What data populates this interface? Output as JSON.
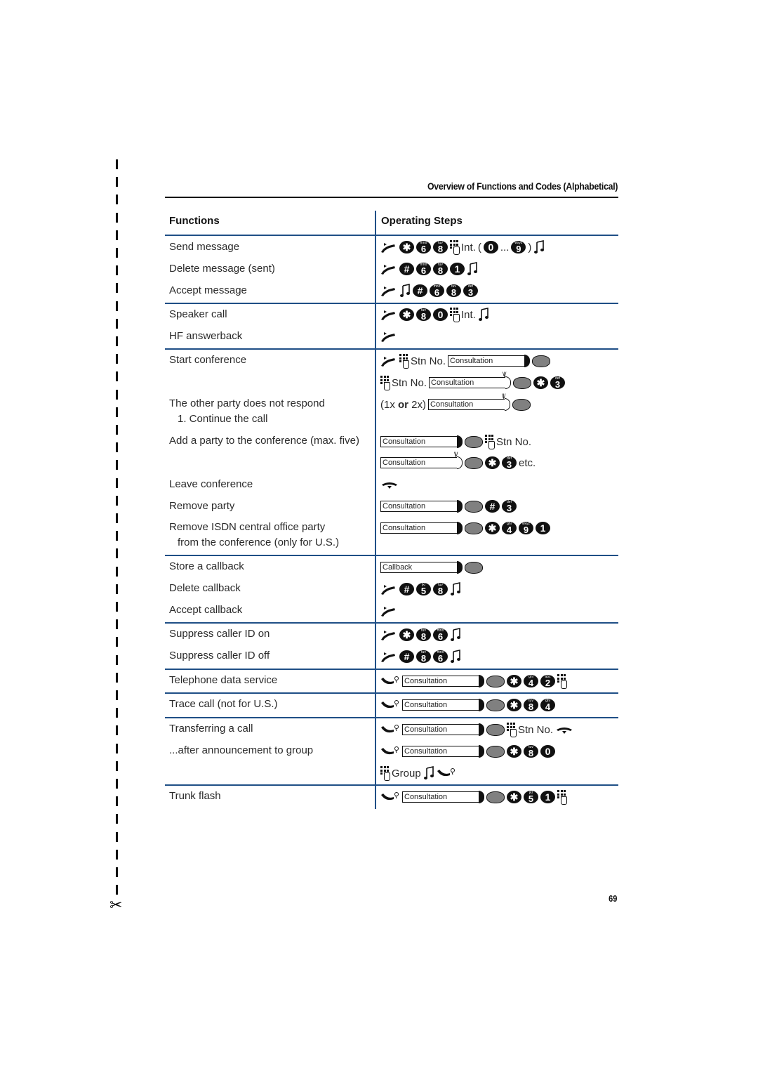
{
  "page": {
    "section_title": "Overview of Functions and Codes (Alphabetical)",
    "page_number": "69",
    "cut_line_icon": "scissors-icon"
  },
  "table": {
    "headers": {
      "functions": "Functions",
      "steps": "Operating Steps"
    },
    "groups": [
      {
        "rows": [
          {
            "function": "Send message",
            "steps": [
              "lift-handset-icon",
              "*",
              "6",
              "8",
              "keypad-icon",
              "Int.",
              "(",
              "0",
              "...",
              "9",
              ")",
              "tone-icon"
            ]
          },
          {
            "function": "Delete message (sent)",
            "steps": [
              "lift-handset-icon",
              "#",
              "6",
              "8",
              "1",
              "tone-icon"
            ]
          },
          {
            "function": "Accept message",
            "steps": [
              "lift-handset-icon",
              "tone-icon",
              "#",
              "6",
              "8",
              "3"
            ]
          }
        ]
      },
      {
        "rows": [
          {
            "function": "Speaker call",
            "steps": [
              "lift-handset-icon",
              "*",
              "8",
              "0",
              "keypad-icon",
              "Int.",
              "tone-icon"
            ]
          },
          {
            "function": "HF answerback",
            "steps": [
              "lift-handset-icon"
            ]
          }
        ]
      },
      {
        "rows": [
          {
            "function": "Start conference",
            "steps": [
              "lift-handset-icon",
              "keypad-icon",
              "Stn No.",
              "Consultation",
              "menu-knob"
            ]
          },
          {
            "function": "",
            "steps": [
              "keypad-icon",
              "Stn No.",
              "Consultation (blinking)",
              "menu-knob",
              "*",
              "3"
            ]
          },
          {
            "function": "The other party does not respond",
            "steps": [
              "(1x or 2x)",
              "Consultation (blinking)",
              "menu-knob"
            ]
          },
          {
            "function": "1. Continue the call",
            "steps": []
          },
          {
            "function": "Add a party to the conference (max. five)",
            "steps": [
              "Consultation",
              "menu-knob",
              "keypad-icon",
              "Stn No."
            ]
          },
          {
            "function": "",
            "steps": [
              "Consultation (blinking)",
              "menu-knob",
              "*",
              "3",
              "etc."
            ]
          },
          {
            "function": "Leave conference",
            "steps": [
              "hang-up-icon"
            ]
          },
          {
            "function": "Remove party",
            "steps": [
              "Consultation",
              "menu-knob",
              "#",
              "3"
            ]
          },
          {
            "function": "Remove ISDN central office party",
            "steps": [
              "Consultation",
              "menu-knob",
              "*",
              "4",
              "9",
              "1"
            ]
          },
          {
            "function": "from the conference (only for U.S.)",
            "steps": []
          }
        ]
      },
      {
        "rows": [
          {
            "function": "Store a callback",
            "steps": [
              "Callback",
              "menu-knob"
            ]
          },
          {
            "function": "Delete callback",
            "steps": [
              "lift-handset-icon",
              "#",
              "5",
              "8",
              "tone-icon"
            ]
          },
          {
            "function": "Accept callback",
            "steps": [
              "lift-handset-icon"
            ]
          }
        ]
      },
      {
        "rows": [
          {
            "function": "Suppress caller ID on",
            "steps": [
              "lift-handset-icon",
              "*",
              "8",
              "6",
              "tone-icon"
            ]
          },
          {
            "function": "Suppress caller ID off",
            "steps": [
              "lift-handset-icon",
              "#",
              "8",
              "6",
              "tone-icon"
            ]
          }
        ]
      },
      {
        "rows": [
          {
            "function": "Telephone data service",
            "steps": [
              "call-active-icon",
              "Consultation",
              "menu-knob",
              "*",
              "4",
              "2",
              "keypad-icon"
            ]
          }
        ]
      },
      {
        "rows": [
          {
            "function": "Trace call (not for U.S.)",
            "steps": [
              "call-active-icon",
              "Consultation",
              "menu-knob",
              "*",
              "8",
              "4"
            ]
          }
        ]
      },
      {
        "rows": [
          {
            "function": "Transferring a call",
            "steps": [
              "call-active-icon",
              "Consultation",
              "menu-knob",
              "keypad-icon",
              "Stn No.",
              "hang-up-icon"
            ]
          },
          {
            "function": "...after announcement to group",
            "steps": [
              "call-active-icon",
              "Consultation",
              "menu-knob",
              "*",
              "8",
              "0"
            ]
          },
          {
            "function": "",
            "steps": [
              "keypad-icon",
              "Group",
              "tone-icon",
              "call-active-icon"
            ]
          }
        ]
      },
      {
        "rows": [
          {
            "function": "Trunk flash",
            "steps": [
              "call-active-icon",
              "Consultation",
              "menu-knob",
              "*",
              "5",
              "1",
              "keypad-icon"
            ]
          }
        ]
      }
    ]
  },
  "labels": {
    "int": "Int.",
    "stn_no": "Stn No.",
    "consultation": "Consultation",
    "callback": "Callback",
    "etc": "etc.",
    "group": "Group",
    "ellipsis": "...",
    "open_paren": "(",
    "close_paren": ")",
    "one_or_two_a": "(1x ",
    "or": "or",
    "one_or_two_b": " 2x)"
  },
  "key_letters": {
    "2": "abc",
    "3": "def",
    "4": "ghi",
    "5": "jkl",
    "6": "mno",
    "8": "tuv",
    "9": "wxyz"
  },
  "colors": {
    "rule": "#1f4f86",
    "text": "#2a2a2a",
    "key": "#111111",
    "knob": "#808080"
  }
}
